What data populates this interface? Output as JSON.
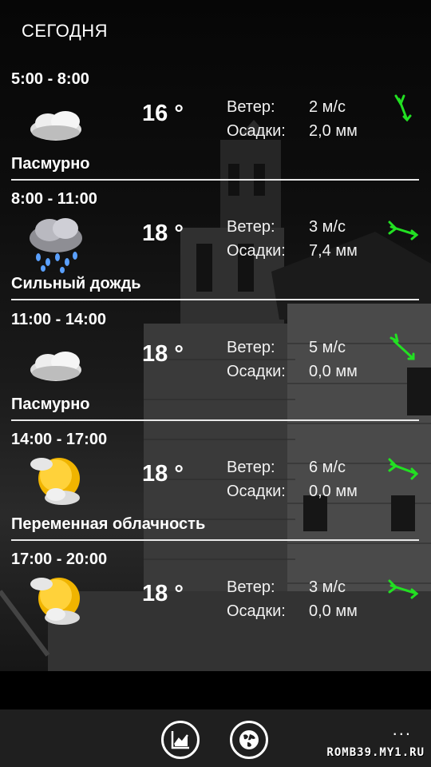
{
  "header": {
    "title": "СЕГОДНЯ"
  },
  "labels": {
    "wind": "Ветер:",
    "precip": "Осадки:"
  },
  "forecasts": [
    {
      "time": "5:00 - 8:00",
      "temp": "16 °",
      "wind": "2 м/с",
      "precip": "2,0 мм",
      "condition": "Пасмурно",
      "icon": "overcast-cloud-icon"
    },
    {
      "time": "8:00 - 11:00",
      "temp": "18 °",
      "wind": "3 м/с",
      "precip": "7,4 мм",
      "condition": "Сильный дождь",
      "icon": "heavy-rain-icon"
    },
    {
      "time": "11:00 - 14:00",
      "temp": "18 °",
      "wind": "5 м/с",
      "precip": "0,0 мм",
      "condition": "Пасмурно",
      "icon": "overcast-cloud-icon"
    },
    {
      "time": "14:00 - 17:00",
      "temp": "18 °",
      "wind": "6 м/с",
      "precip": "0,0 мм",
      "condition": "Переменная облачность",
      "icon": "partly-cloudy-icon"
    },
    {
      "time": "17:00 - 20:00",
      "temp": "18 °",
      "wind": "3 м/с",
      "precip": "0,0 мм",
      "condition": "",
      "icon": "partly-cloudy-icon"
    }
  ],
  "appbar": {
    "buttons": [
      "chart-icon",
      "globe-icon"
    ],
    "more": "...",
    "watermark": "ROMB39.MY1.RU"
  },
  "colors": {
    "wind_arrow": "#22e022",
    "rule": "#e8e8e8",
    "appbar": "#1f1f1f"
  }
}
